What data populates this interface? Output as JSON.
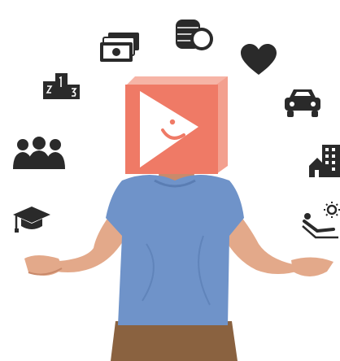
{
  "scene": {
    "subject": "person-with-logo-box-head",
    "colors": {
      "icon": "#2a2a2a",
      "box_front": "#ef7a66",
      "box_side": "#f3a08f",
      "box_top": "#f6b4a6",
      "shirt": "#6f93c9",
      "shirt_shadow": "#5a7db3",
      "skin": "#e3a98a",
      "skin_shadow": "#c98a6b",
      "pants": "#8a6240"
    }
  },
  "icons": [
    "cash-icon",
    "coins-icon",
    "heart-icon",
    "podium-icon",
    "car-icon",
    "family-icon",
    "house-building-icon",
    "graduation-cap-icon",
    "relaxing-sun-icon"
  ]
}
